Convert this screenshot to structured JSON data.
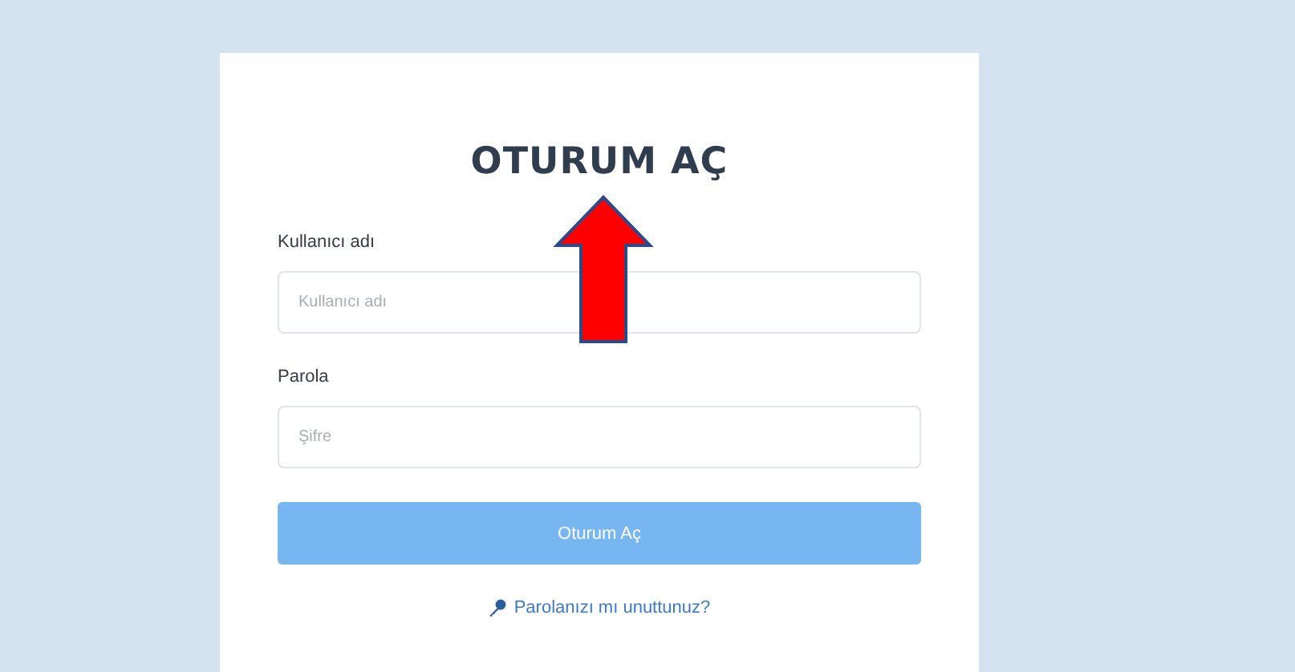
{
  "login_form": {
    "title": "OTURUM AÇ",
    "fields": [
      {
        "label": "Kullanıcı adı",
        "placeholder": "Kullanıcı adı"
      },
      {
        "label": "Parola",
        "placeholder": "Şifre"
      }
    ],
    "submit_button": "Oturum Aç",
    "forgot_link": "Parolanızı mı unuttunuz?"
  }
}
